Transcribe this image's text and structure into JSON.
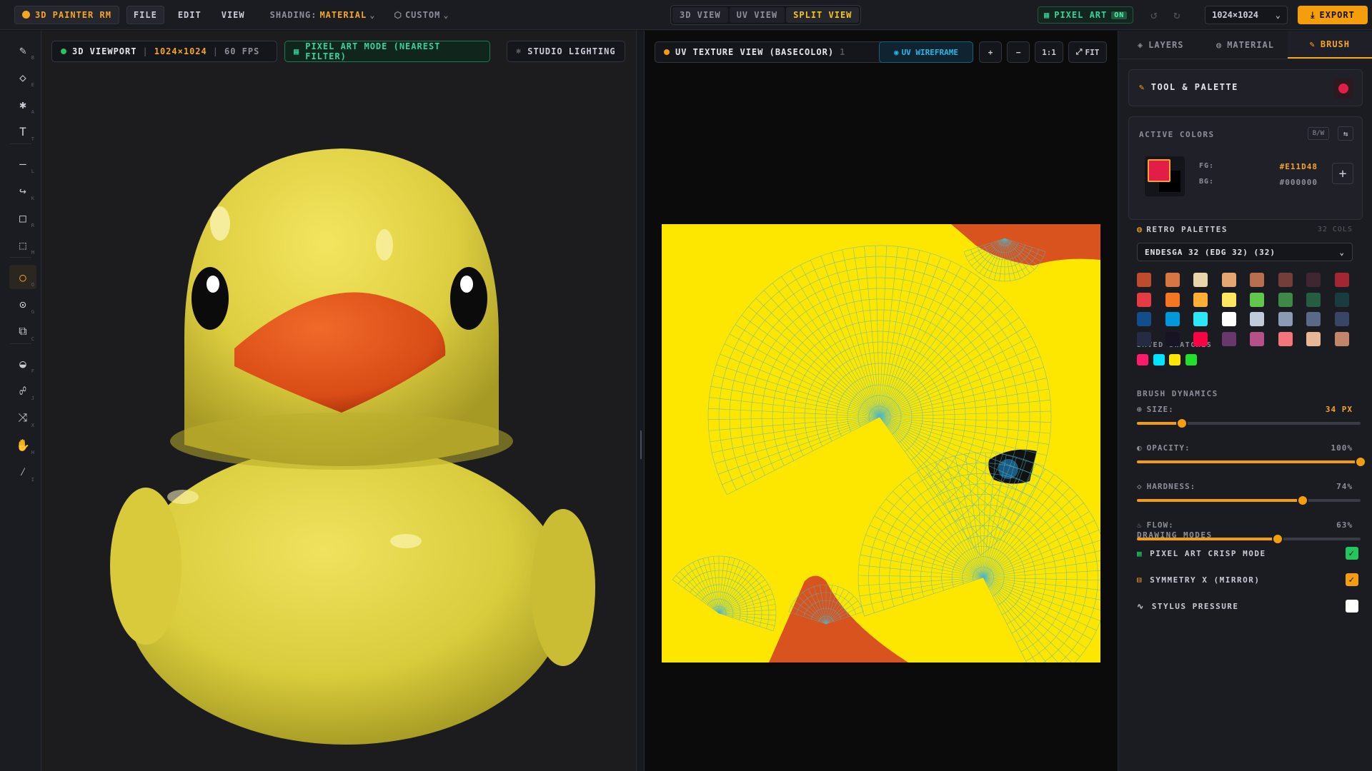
{
  "app": {
    "title": "3D PAINTER RM"
  },
  "menu": {
    "file": "FILE",
    "edit": "EDIT",
    "view": "VIEW",
    "shading_label": "SHADING:",
    "shading_value": "MATERIAL",
    "custom": "CUSTOM"
  },
  "view_modes": [
    "3D VIEW",
    "UV VIEW",
    "SPLIT VIEW"
  ],
  "pixel_art_badge": {
    "label": "PIXEL ART",
    "state": "ON"
  },
  "resolution_select": "1024×1024",
  "export_label": "EXPORT",
  "tools": [
    {
      "name": "brush-tool",
      "key": "B"
    },
    {
      "name": "eraser-tool",
      "key": "E"
    },
    {
      "name": "spray-tool",
      "key": "A"
    },
    {
      "name": "text-tool",
      "key": "T"
    },
    {
      "name": "line-tool",
      "key": "L"
    },
    {
      "name": "curve-tool",
      "key": "K"
    },
    {
      "name": "rectangle-tool",
      "key": "R"
    },
    {
      "name": "selection-tool",
      "key": "M"
    },
    {
      "name": "ellipse-tool",
      "key": "O"
    },
    {
      "name": "radial-tool",
      "key": "G"
    },
    {
      "name": "clone-tool",
      "key": "C"
    },
    {
      "name": "fill-tool",
      "key": "F"
    },
    {
      "name": "smudge-tool",
      "key": "J"
    },
    {
      "name": "shuffle-tool",
      "key": "X"
    },
    {
      "name": "hand-tool",
      "key": "H"
    },
    {
      "name": "eyedropper-tool",
      "key": "I"
    }
  ],
  "viewport3d": {
    "title": "3D VIEWPORT",
    "resolution": "1024×1024",
    "fps": "60 FPS",
    "pixel_mode": "PIXEL ART MODE (NEAREST FILTER)",
    "lighting": "STUDIO LIGHTING"
  },
  "uvview": {
    "title": "UV TEXTURE VIEW (BASECOLOR)",
    "separator": "1",
    "wireframe": "UV WIREFRAME",
    "zoom_in": "+",
    "zoom_out": "−",
    "ratio": "1:1",
    "fit": "FIT"
  },
  "right_tabs": [
    "LAYERS",
    "MATERIAL",
    "BRUSH"
  ],
  "tool_palette": {
    "title": "TOOL & PALETTE"
  },
  "active_colors": {
    "title": "ACTIVE COLORS",
    "bw_label": "B/W",
    "fg_label": "FG:",
    "fg_value": "#E11D48",
    "bg_label": "BG:",
    "bg_value": "#000000",
    "fg_color": "#e11d48",
    "bg_color": "#000000"
  },
  "palettes": {
    "title": "RETRO PALETTES",
    "count": "32 COLS",
    "selected": "ENDESGA 32 (EDG 32) (32)",
    "colors": [
      "#be4a2f",
      "#d77643",
      "#ead4aa",
      "#e4a672",
      "#b86f50",
      "#733e39",
      "#3e2731",
      "#a22633",
      "#e43b44",
      "#f77622",
      "#feae34",
      "#fee761",
      "#63c74d",
      "#3e8948",
      "#265c42",
      "#193c3e",
      "#124e89",
      "#0099db",
      "#2ce8f5",
      "#ffffff",
      "#c0cbdc",
      "#8b9bb4",
      "#5a6988",
      "#3a4466",
      "#262b44",
      "#181425",
      "#ff0044",
      "#68386c",
      "#b55088",
      "#f6757a",
      "#e8b796",
      "#c28569"
    ]
  },
  "saved_swatches": {
    "title": "SAVED SWATCHES",
    "colors": [
      "#ff1a6c",
      "#00e5ff",
      "#ffe600",
      "#22e02b"
    ]
  },
  "brush_dynamics": {
    "title": "BRUSH DYNAMICS",
    "size": {
      "label": "SIZE:",
      "value": "34 PX",
      "fraction": 0.2
    },
    "opacity": {
      "label": "OPACITY:",
      "value": "100%",
      "fraction": 1.0
    },
    "hardness": {
      "label": "HARDNESS:",
      "value": "74%",
      "fraction": 0.74
    },
    "flow": {
      "label": "FLOW:",
      "value": "63%",
      "fraction": 0.63
    }
  },
  "drawing_modes": {
    "title": "DRAWING MODES",
    "items": [
      {
        "label": "PIXEL ART CRISP MODE",
        "checked": true,
        "color": "#22c55e"
      },
      {
        "label": "SYMMETRY X (MIRROR)",
        "checked": true,
        "color": "#f59e0b"
      },
      {
        "label": "STYLUS PRESSURE",
        "checked": false,
        "color": "#ffffff"
      }
    ]
  },
  "colors": {
    "accent": "#f59e0b",
    "green": "#34d399",
    "uv_accent": "#22b8e8",
    "texture_yellow": "#fde600",
    "beak_orange": "#d9531e"
  }
}
